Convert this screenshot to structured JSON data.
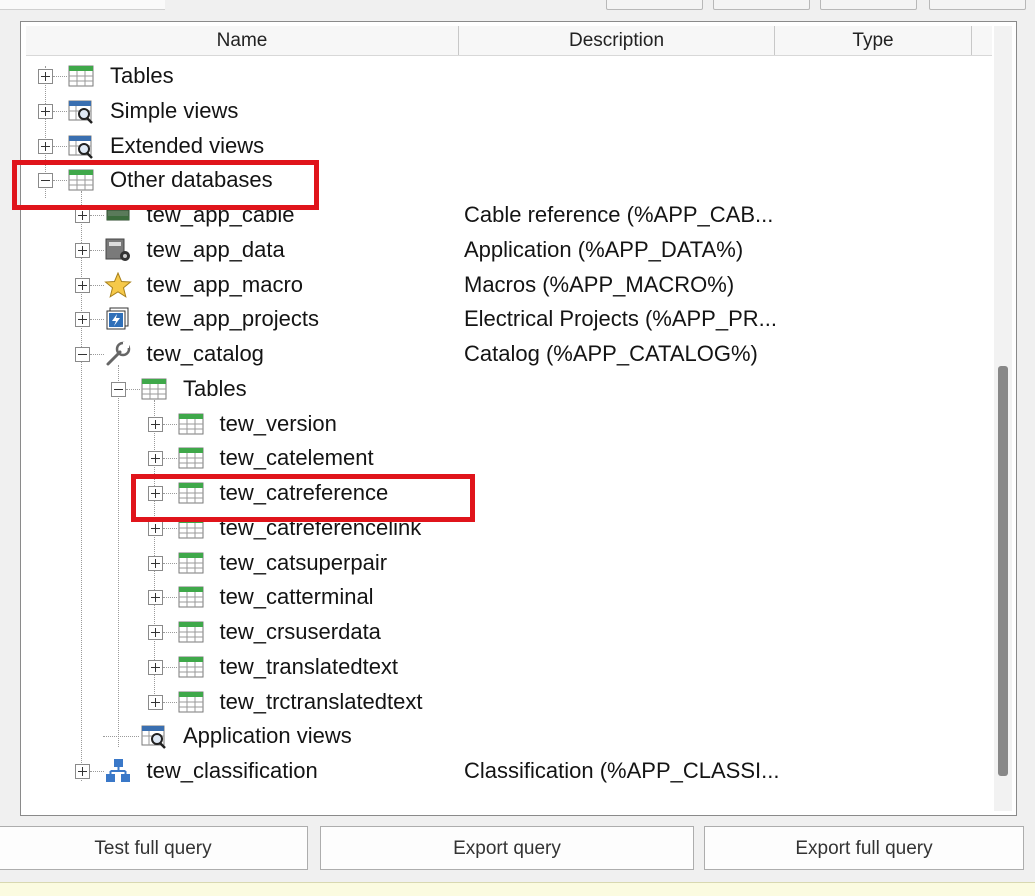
{
  "columns": {
    "name": "Name",
    "description": "Description",
    "type": "Type"
  },
  "tree": [
    {
      "label": "Tables",
      "description": "",
      "icon": "table-icon",
      "expander": "plus"
    },
    {
      "label": "Simple views",
      "description": "",
      "icon": "view-icon",
      "expander": "plus"
    },
    {
      "label": "Extended views",
      "description": "",
      "icon": "view-icon",
      "expander": "plus"
    },
    {
      "label": "Other databases",
      "description": "",
      "icon": "table-icon",
      "expander": "minus"
    },
    {
      "label": "tew_app_cable",
      "description": "Cable reference (%APP_CAB...",
      "icon": "cable-icon",
      "expander": "plus"
    },
    {
      "label": "tew_app_data",
      "description": "Application (%APP_DATA%)",
      "icon": "app-data-icon",
      "expander": "plus"
    },
    {
      "label": "tew_app_macro",
      "description": "Macros (%APP_MACRO%)",
      "icon": "star-icon",
      "expander": "plus"
    },
    {
      "label": "tew_app_projects",
      "description": "Electrical Projects (%APP_PR...",
      "icon": "projects-icon",
      "expander": "plus"
    },
    {
      "label": "tew_catalog",
      "description": "Catalog (%APP_CATALOG%)",
      "icon": "wrench-icon",
      "expander": "minus"
    },
    {
      "label": "Tables",
      "description": "",
      "icon": "table-icon",
      "expander": "minus"
    },
    {
      "label": "tew_version",
      "description": "",
      "icon": "table-icon",
      "expander": "plus"
    },
    {
      "label": "tew_catelement",
      "description": "",
      "icon": "table-icon",
      "expander": "plus"
    },
    {
      "label": "tew_catreference",
      "description": "",
      "icon": "table-icon",
      "expander": "plus"
    },
    {
      "label": "tew_catreferencelink",
      "description": "",
      "icon": "table-icon",
      "expander": "plus"
    },
    {
      "label": "tew_catsuperpair",
      "description": "",
      "icon": "table-icon",
      "expander": "plus"
    },
    {
      "label": "tew_catterminal",
      "description": "",
      "icon": "table-icon",
      "expander": "plus"
    },
    {
      "label": "tew_crsuserdata",
      "description": "",
      "icon": "table-icon",
      "expander": "plus"
    },
    {
      "label": "tew_translatedtext",
      "description": "",
      "icon": "table-icon",
      "expander": "plus"
    },
    {
      "label": "tew_trctranslatedtext",
      "description": "",
      "icon": "table-icon",
      "expander": "plus"
    },
    {
      "label": "Application views",
      "description": "",
      "icon": "view-icon",
      "expander": "none"
    },
    {
      "label": "tew_classification",
      "description": "Classification (%APP_CLASSI...",
      "icon": "hierarchy-icon",
      "expander": "plus"
    }
  ],
  "buttons": {
    "test_full_query": "Test full query",
    "export_query": "Export query",
    "export_full_query": "Export full query"
  },
  "colors": {
    "highlight": "#e0141b",
    "table_icon_header": "#3fa84a"
  }
}
